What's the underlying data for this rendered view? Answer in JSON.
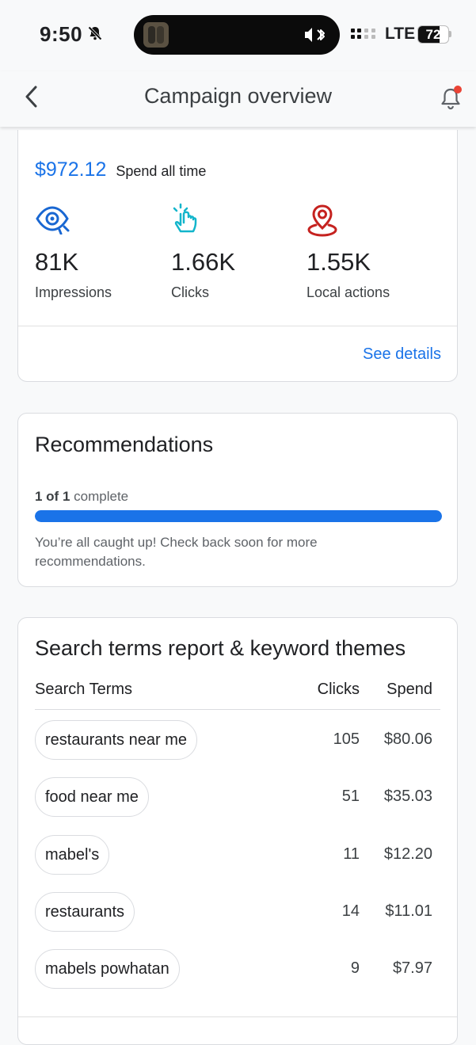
{
  "status_bar": {
    "time": "9:50",
    "network": "LTE",
    "battery": "72",
    "battery_level": 0.72
  },
  "header": {
    "title": "Campaign overview"
  },
  "summary": {
    "spend_amount": "$972.12",
    "spend_label": "Spend all time",
    "metrics": [
      {
        "value": "81K",
        "label": "Impressions",
        "icon": "eye-icon",
        "color": "#1967d2"
      },
      {
        "value": "1.66K",
        "label": "Clicks",
        "icon": "tap-icon",
        "color": "#12b5cb"
      },
      {
        "value": "1.55K",
        "label": "Local actions",
        "icon": "location-pin-icon",
        "color": "#c5221f"
      }
    ],
    "see_details": "See details"
  },
  "recommendations": {
    "title": "Recommendations",
    "progress_bold": "1 of 1",
    "progress_suffix": "complete",
    "progress": 1.0,
    "note": "You’re all caught up! Check back soon for more recommendations."
  },
  "search_terms": {
    "title": "Search terms report & keyword themes",
    "columns": [
      "Search Terms",
      "Clicks",
      "Spend"
    ],
    "rows": [
      {
        "term": "restaurants near me",
        "clicks": "105",
        "spend": "$80.06"
      },
      {
        "term": "food near me",
        "clicks": "51",
        "spend": "$35.03"
      },
      {
        "term": "mabel's",
        "clicks": "11",
        "spend": "$12.20"
      },
      {
        "term": "restaurants",
        "clicks": "14",
        "spend": "$11.01"
      },
      {
        "term": "mabels powhatan",
        "clicks": "9",
        "spend": "$7.97"
      }
    ]
  },
  "colors": {
    "accent": "#1a73e8",
    "notification_dot": "#ea4335"
  }
}
